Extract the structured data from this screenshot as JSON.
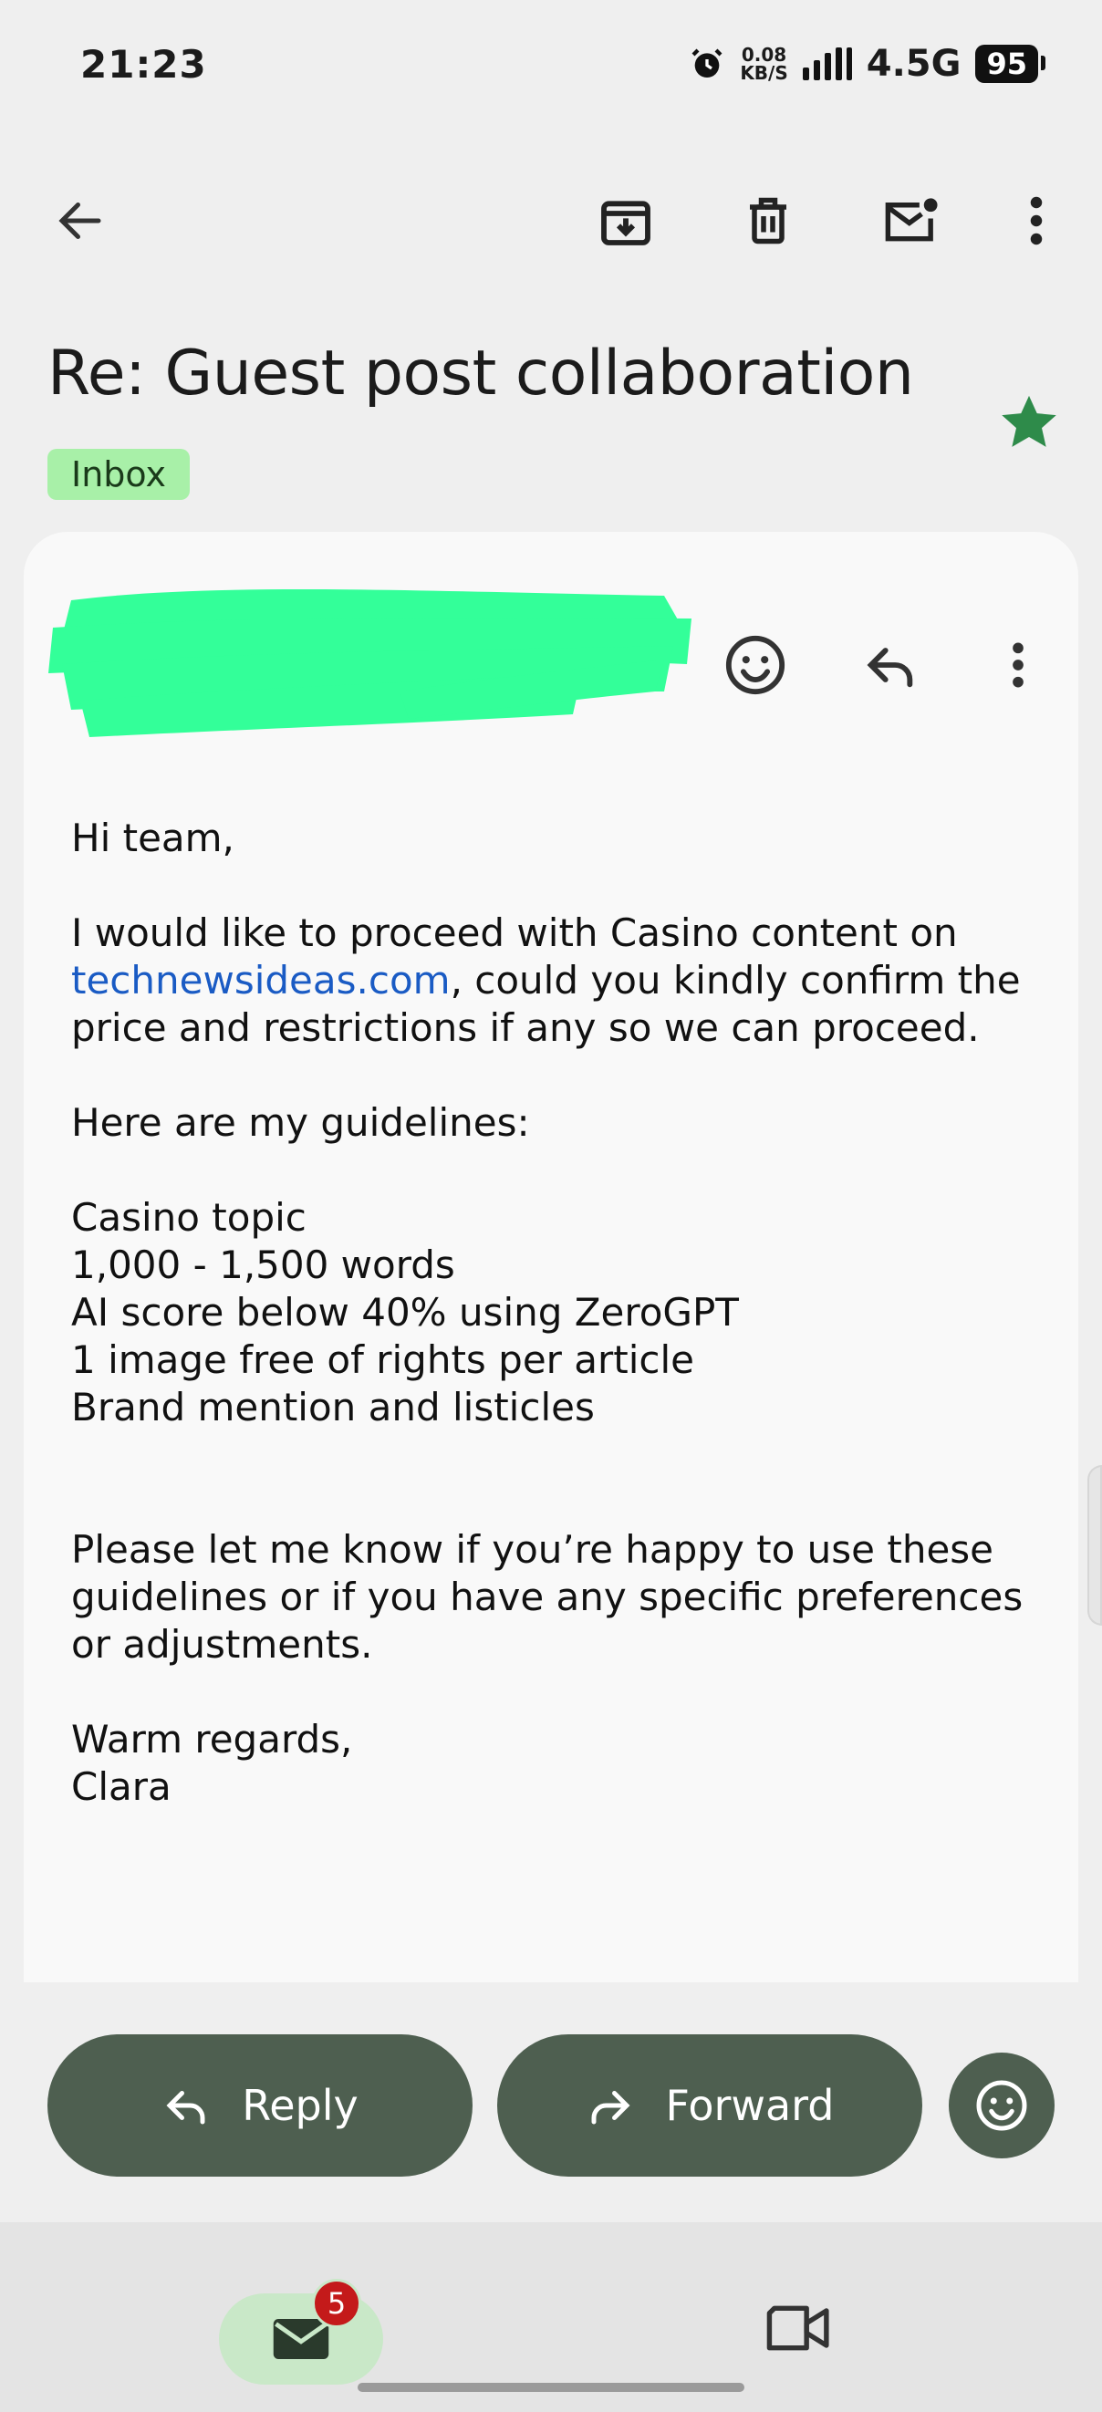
{
  "status": {
    "time": "21:23",
    "net_speed_top": "0.08",
    "net_speed_bottom": "KB/S",
    "network": "4.5G",
    "battery": "95"
  },
  "toolbar": {
    "icons": [
      "back-arrow-icon",
      "archive-icon",
      "delete-icon",
      "mark-unread-icon",
      "more-vert-icon"
    ]
  },
  "email": {
    "subject": "Re: Guest post collaboration",
    "label": "Inbox",
    "starred": true,
    "star_color": "#2e8b4a",
    "greeting": "Hi team,",
    "para1_pre": "I would like to proceed with Casino content on ",
    "para1_link": "technewsideas.com",
    "para1_post": ", could you kindly confirm the price and restrictions if any so we can proceed.",
    "guidelines_intro": "Here are my guidelines:",
    "guidelines": [
      "Casino topic",
      "1,000 - 1,500 words",
      "AI score below 40% using ZeroGPT",
      "1 image free of rights per article",
      "Brand mention and listicles"
    ],
    "para3": "Please let me know if you’re happy to use these guidelines or if you have any specific preferences or adjustments.",
    "signoff": "Warm regards,",
    "signature": "Clara"
  },
  "actions": {
    "reply_label": "Reply",
    "forward_label": "Forward",
    "button_color": "#4e5f50"
  },
  "nav": {
    "mail_badge": "5"
  },
  "colors": {
    "redaction": "#33ff99",
    "link": "#1a5bc4",
    "chip_bg": "#a8f0a8"
  }
}
